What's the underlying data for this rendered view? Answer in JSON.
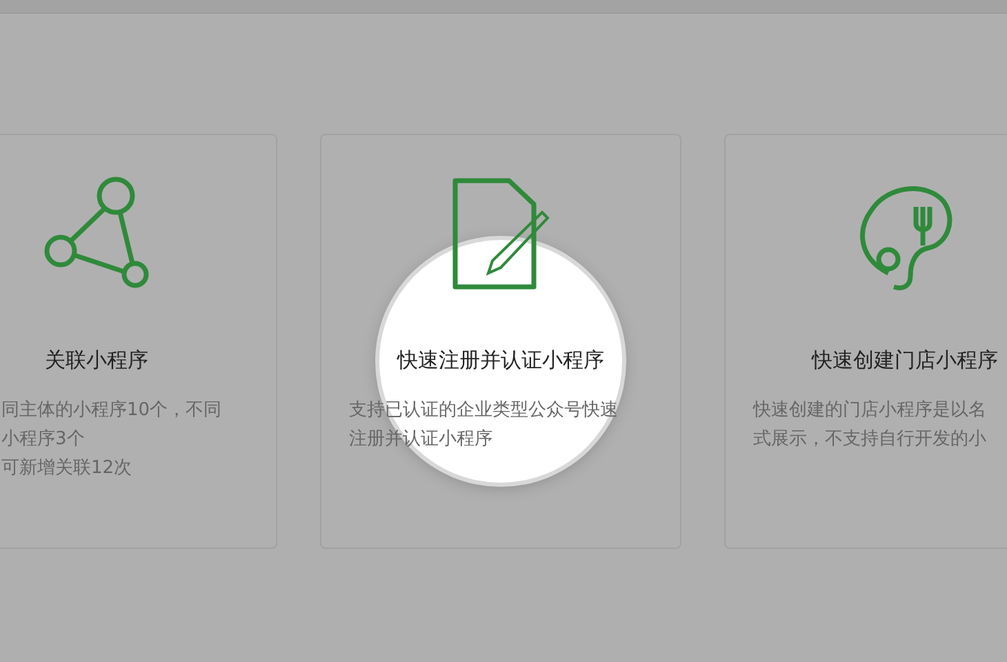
{
  "cards": [
    {
      "kind": "link",
      "title": "关联小程序",
      "lines": [
        "同主体的小程序10个，不同",
        "小程序3个",
        "可新增关联12次"
      ],
      "highlighted": false
    },
    {
      "kind": "register",
      "title": "快速注册并认证小程序",
      "lines": [
        "支持已认证的企业类型公众号快速",
        "注册并认证小程序"
      ],
      "highlighted": true
    },
    {
      "kind": "store",
      "title": "快速创建门店小程序",
      "lines": [
        "快速创建的门店小程序是以名",
        "式展示，不支持自行开发的小"
      ],
      "highlighted": false
    }
  ]
}
